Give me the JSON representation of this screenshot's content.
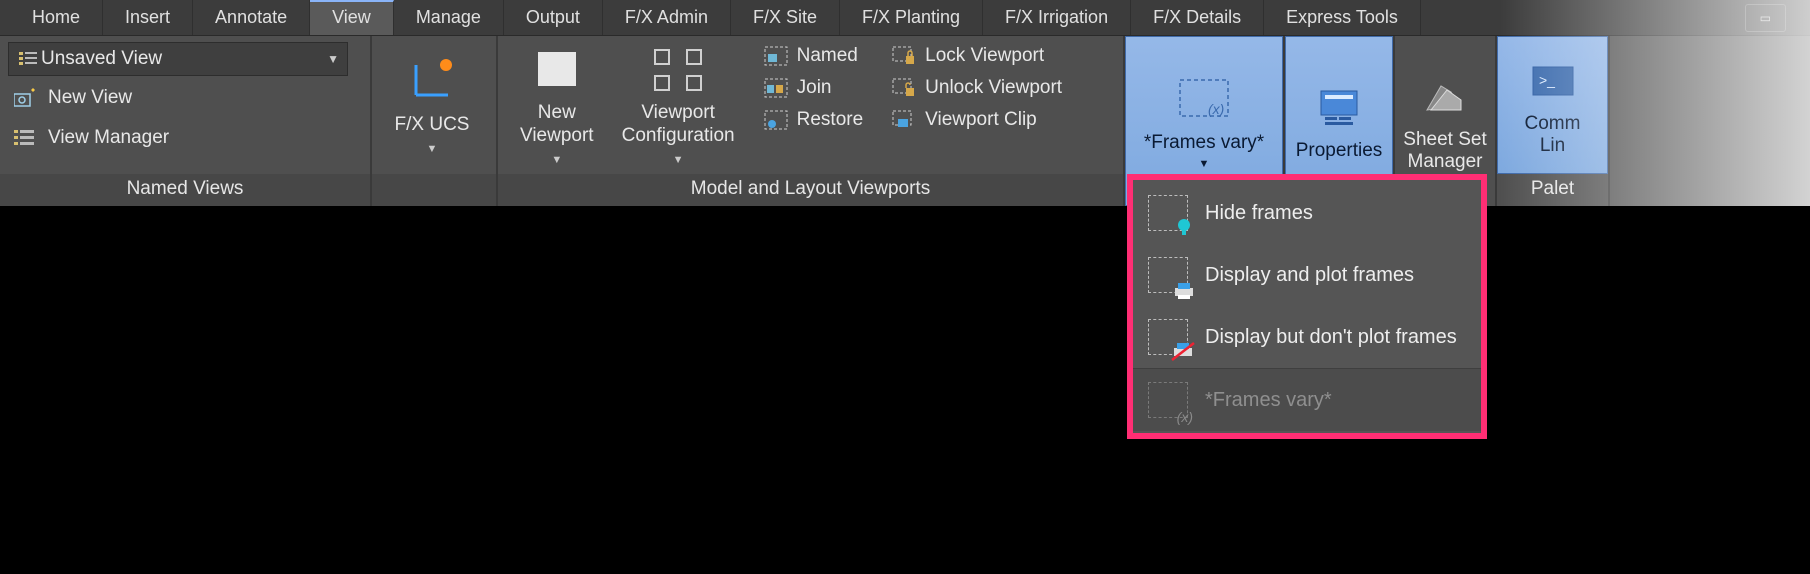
{
  "tabs": [
    "Home",
    "Insert",
    "Annotate",
    "View",
    "Manage",
    "Output",
    "F/X Admin",
    "F/X Site",
    "F/X Planting",
    "F/X Irrigation",
    "F/X Details",
    "Express Tools"
  ],
  "active_tab_index": 3,
  "panels": {
    "named_views": {
      "title": "Named Views",
      "combo": "Unsaved View",
      "new_view": "New View",
      "view_manager": "View Manager"
    },
    "ucs": {
      "label": "F/X UCS"
    },
    "viewports": {
      "title": "Model and Layout Viewports",
      "new_viewport": "New\nViewport",
      "vp_config": "Viewport\nConfiguration",
      "named": "Named",
      "join": "Join",
      "restore": "Restore",
      "lock": "Lock Viewport",
      "unlock": "Unlock Viewport",
      "clip": "Viewport Clip"
    },
    "right": {
      "frames_vary": "*Frames vary*",
      "properties": "Properties",
      "sheetset": "Sheet Set\nManager",
      "command": "Comm\nLin",
      "palettes": "Palet"
    }
  },
  "dropdown": {
    "hide": "Hide frames",
    "display_plot": "Display and plot frames",
    "display_noplot": "Display but don't plot frames",
    "vary": "*Frames vary*"
  }
}
